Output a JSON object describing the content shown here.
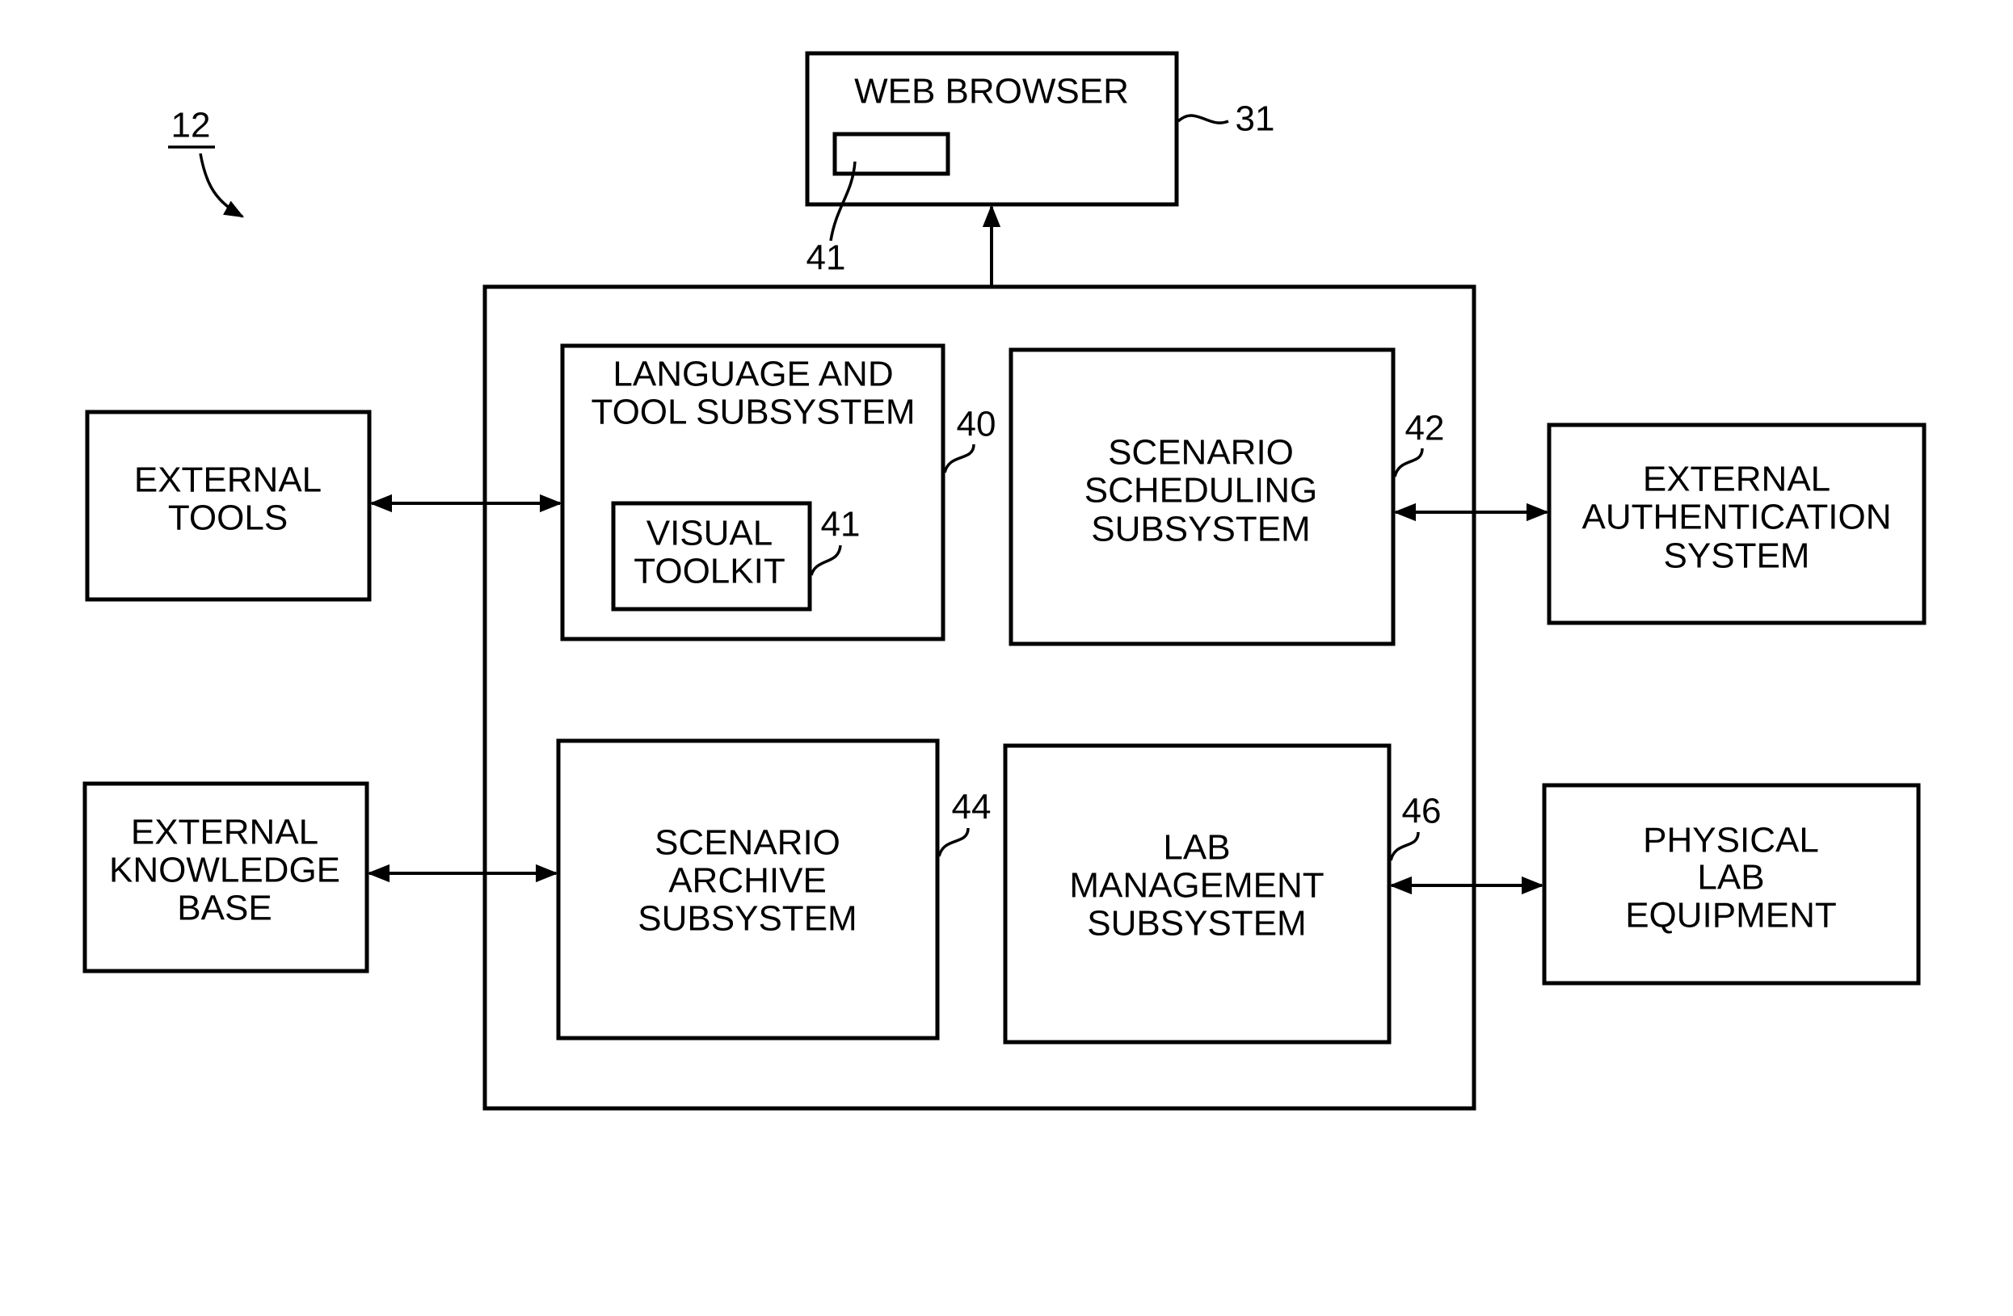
{
  "figure": {
    "reference": "12"
  },
  "web_browser": {
    "label": "WEB BROWSER",
    "ref": "31",
    "inner_ref": "41"
  },
  "system": {
    "language_tool": {
      "lines": [
        "LANGUAGE AND",
        "TOOL SUBSYSTEM"
      ],
      "ref": "40"
    },
    "visual_toolkit": {
      "lines": [
        "VISUAL",
        "TOOLKIT"
      ],
      "ref": "41"
    },
    "scenario_scheduling": {
      "lines": [
        "SCENARIO",
        "SCHEDULING",
        "SUBSYSTEM"
      ],
      "ref": "42"
    },
    "scenario_archive": {
      "lines": [
        "SCENARIO",
        "ARCHIVE",
        "SUBSYSTEM"
      ],
      "ref": "44"
    },
    "lab_management": {
      "lines": [
        "LAB",
        "MANAGEMENT",
        "SUBSYSTEM"
      ],
      "ref": "46"
    }
  },
  "external": {
    "tools": {
      "lines": [
        "EXTERNAL",
        "TOOLS"
      ]
    },
    "authentication": {
      "lines": [
        "EXTERNAL",
        "AUTHENTICATION",
        "SYSTEM"
      ]
    },
    "knowledge_base": {
      "lines": [
        "EXTERNAL",
        "KNOWLEDGE",
        "BASE"
      ]
    },
    "physical_lab": {
      "lines": [
        "PHYSICAL",
        "LAB",
        "EQUIPMENT"
      ]
    }
  }
}
